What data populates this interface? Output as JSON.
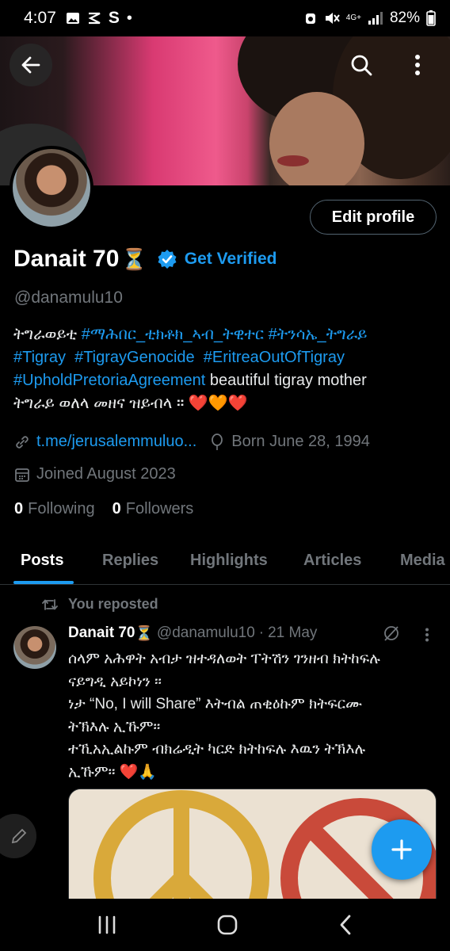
{
  "status_bar": {
    "time": "4:07",
    "carrier_icon": "S",
    "dot": "•",
    "network": "4G+",
    "battery": "82%"
  },
  "header": {
    "back_icon": "arrow-left-icon",
    "search_icon": "search-icon",
    "more_icon": "more-vertical-icon"
  },
  "profile": {
    "display_name": "Danait 70",
    "name_emoji": "⏳",
    "verify_label": "Get Verified",
    "handle": "@danamulu10",
    "edit_label": "Edit profile",
    "bio": {
      "segments": [
        {
          "text": "ትግራወይቲ ",
          "tag": false
        },
        {
          "text": "#ማሕበር_ቲክቶክ_ኣብ_ትዊተር",
          "tag": true
        },
        {
          "text": " ",
          "tag": false
        },
        {
          "text": "#ትንሳኤ_ትግራይ",
          "tag": true
        }
      ],
      "line2": [
        "#Tigray",
        "#TigrayGenocide",
        "#EritreaOutOfTigray"
      ],
      "line3_tag": "#UpholdPretoriaAgreement",
      "line3_text": " beautiful tigray mother",
      "line4": "ትግራይ ወለላ መዘና ዝይብላ ።",
      "hearts": "❤️🧡❤️"
    },
    "link": "t.me/jerusalemmuluo...",
    "born": "Born June 28, 1994",
    "joined": "Joined August 2023",
    "following_count": "0",
    "following_label": "Following",
    "followers_count": "0",
    "followers_label": "Followers"
  },
  "tabs": [
    "Posts",
    "Replies",
    "Highlights",
    "Articles",
    "Media"
  ],
  "post": {
    "repost_label": "You reposted",
    "author_name": "Danait 70",
    "author_emoji": "⏳",
    "author_handle": "@danamulu10",
    "date": "21 May",
    "lines": [
      "ሰላም አሕዋት አብታ ዝተዳለወት ፐትሽን ገንዘብ ክትከፍሉ",
      "ናይግዲ አይኮነን ።",
      "ነታ “No, I will Share” እትብል ጠቂዕኩም ክትፍርሙ",
      "ትኽእሉ ኢኹም።",
      "ተኺአኢልኩም ብክሬዲት ካርድ ክትከፍሉ እዉን  ትኽእሉ",
      "ኢኹም። ❤️🙏"
    ]
  },
  "colors": {
    "accent": "#1d9bf0",
    "background": "#000000",
    "muted": "#71767b",
    "heart_red": "#e0245e"
  }
}
